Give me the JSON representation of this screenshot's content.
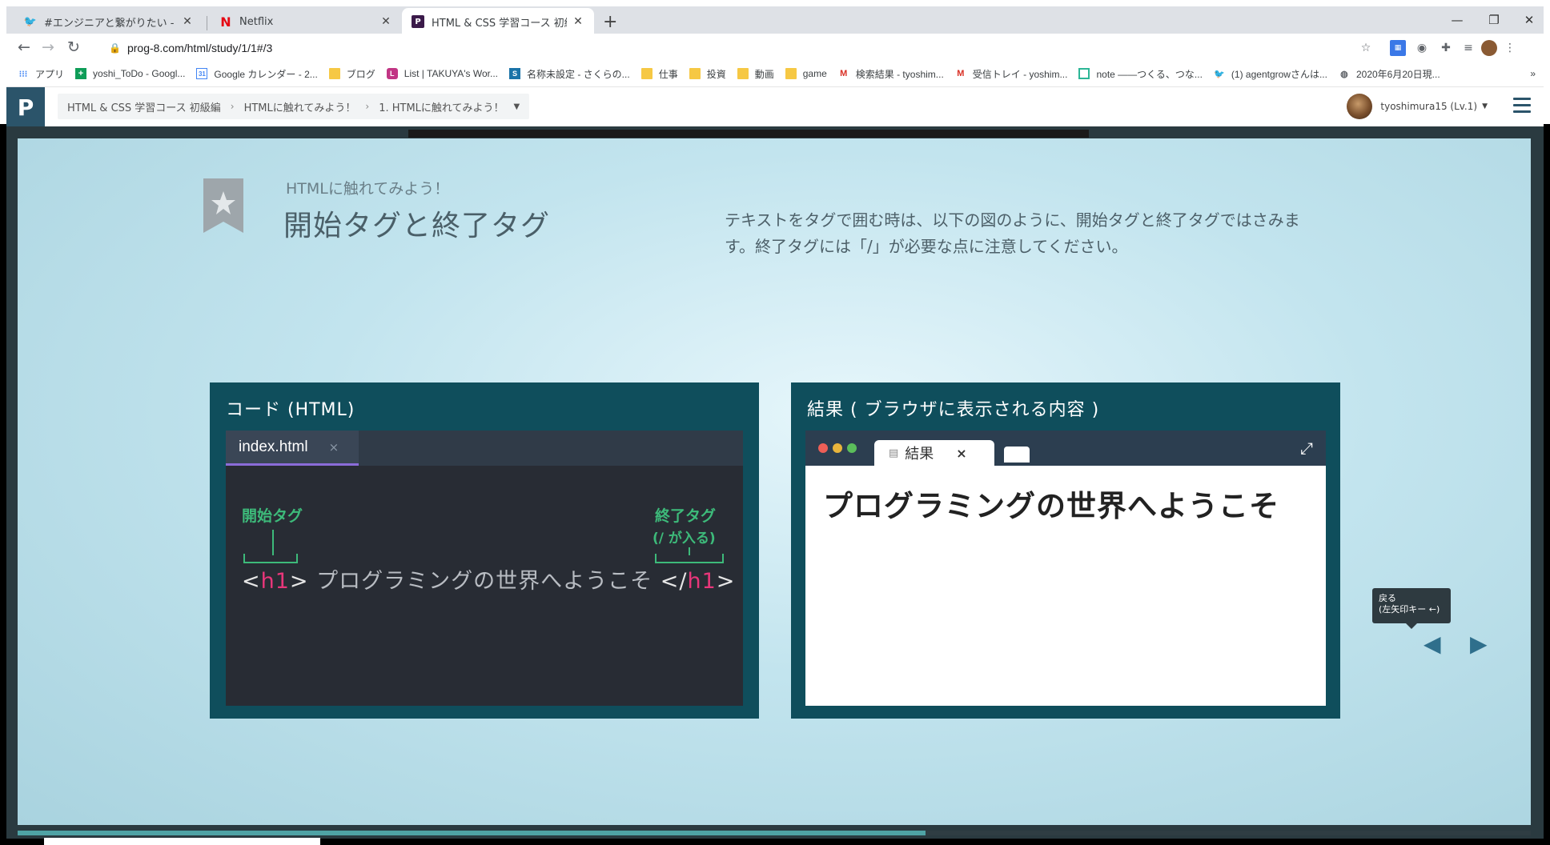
{
  "browser": {
    "tabs": [
      {
        "title": "#エンジニアと繋がりたい - Twitter検索",
        "active": false
      },
      {
        "title": "Netflix",
        "active": false
      },
      {
        "title": "HTML & CSS 学習コース 初級編 | Progate",
        "active": true
      }
    ],
    "url": "prog-8.com/html/study/1/1#/3",
    "bookmarks": [
      "アプリ",
      "yoshi_ToDo - Googl...",
      "Google カレンダー - 2...",
      "ブログ",
      "List | TAKUYA's Wor...",
      "名称未設定 - さくらの...",
      "仕事",
      "投資",
      "動画",
      "game",
      "検索結果 - tyoshim...",
      "受信トレイ - yoshim...",
      "note ——つくる、つな...",
      "(1) agentgrowさんは...",
      "2020年6月20日現..."
    ]
  },
  "header": {
    "breadcrumbs": [
      "HTML & CSS 学習コース 初級編",
      "HTMLに触れてみよう！",
      "1. HTMLに触れてみよう！"
    ],
    "username": "tyoshimura15 (Lv.1)"
  },
  "slide": {
    "subtitle": "HTMLに触れてみよう！",
    "title": "開始タグと終了タグ",
    "description": "テキストをタグで囲む時は、以下の図のように、開始タグと終了タグではさみます。終了タグには「/」が必要な点に注意してください。",
    "code_panel": {
      "title": "コード (HTML)",
      "filename": "index.html",
      "close": "×",
      "start_label": "開始タグ",
      "end_label": "終了タグ",
      "end_note": "(/ が入る)",
      "open_bracket": "<",
      "tag": "h1",
      "close_bracket": ">",
      "content": "プログラミングの世界へようこそ",
      "end_open": "</"
    },
    "result_panel": {
      "title": "結果 ( ブラウザに表示される内容 )",
      "tab_label": "結果",
      "close": "×",
      "heading": "プログラミングの世界へようこそ"
    },
    "tooltip": {
      "line1": "戻る",
      "line2": "(左矢印キー ←)"
    },
    "progress": 0.6
  }
}
